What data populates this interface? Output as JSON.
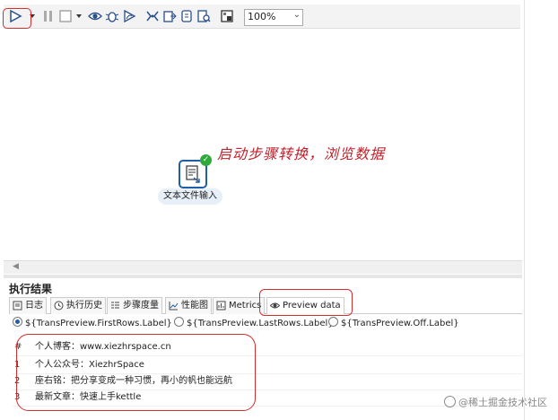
{
  "toolbar": {
    "zoom": "100%",
    "icons": [
      "run-icon",
      "run-options-icon",
      "pause-icon",
      "stop-icon",
      "stop-options-icon",
      "preview-icon",
      "debug-icon",
      "replay-icon",
      "verify-icon",
      "impact-icon",
      "sql-icon",
      "explore-db-icon",
      "show-results-icon"
    ]
  },
  "canvas": {
    "step_label": "文本文件输入",
    "annotation": "启动步骤转换，浏览数据"
  },
  "results": {
    "title": "执行结果",
    "tabs": [
      {
        "label": "日志",
        "icon": "log-icon"
      },
      {
        "label": "执行历史",
        "icon": "history-icon"
      },
      {
        "label": "步骤度量",
        "icon": "step-metrics-icon"
      },
      {
        "label": "性能图",
        "icon": "perf-graph-icon"
      },
      {
        "label": "Metrics",
        "icon": "metrics-icon"
      },
      {
        "label": "Preview data",
        "icon": "preview-eye-icon"
      }
    ],
    "radios": [
      {
        "label": "${TransPreview.FirstRows.Label}",
        "selected": true
      },
      {
        "label": "${TransPreview.LastRows.Label}",
        "selected": false
      },
      {
        "label": "${TransPreview.Off.Label}",
        "selected": false
      }
    ],
    "grid": {
      "header_num": "#",
      "header_col": "个人博客：www.xiezhrspace.cn",
      "rows": [
        {
          "num": "1",
          "text": "个人公众号：XiezhrSpace"
        },
        {
          "num": "2",
          "text": "座右铭：把分享变成一种习惯，再小的帆也能远航"
        },
        {
          "num": "3",
          "text": "最新文章：快速上手kettle"
        }
      ]
    }
  },
  "watermark": "@稀土掘金技术社区",
  "colors": {
    "highlight": "#d03030",
    "accent": "#1f5fa8",
    "success": "#2faa3a",
    "annotation": "#c0202a"
  }
}
